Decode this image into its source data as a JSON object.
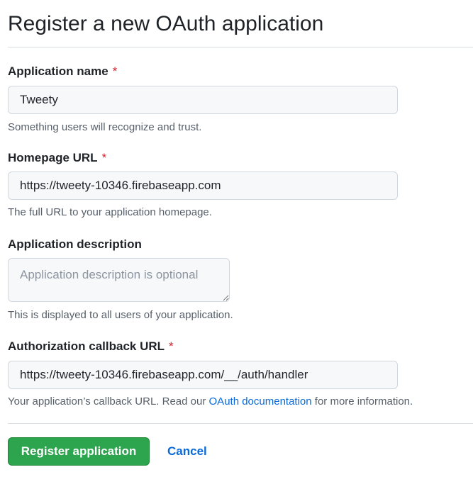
{
  "header": {
    "title": "Register a new OAuth application"
  },
  "form": {
    "app_name": {
      "label": "Application name",
      "required_mark": "*",
      "value": "Tweety",
      "hint": "Something users will recognize and trust."
    },
    "homepage_url": {
      "label": "Homepage URL",
      "required_mark": "*",
      "value": "https://tweety-10346.firebaseapp.com",
      "hint": "The full URL to your application homepage."
    },
    "description": {
      "label": "Application description",
      "value": "",
      "placeholder": "Application description is optional",
      "hint": "This is displayed to all users of your application."
    },
    "callback_url": {
      "label": "Authorization callback URL",
      "required_mark": "*",
      "value": "https://tweety-10346.firebaseapp.com/__/auth/handler",
      "hint_prefix": "Your application’s callback URL. Read our",
      "hint_link": "OAuth documentation",
      "hint_suffix": "for more information."
    }
  },
  "actions": {
    "submit_label": "Register application",
    "cancel_label": "Cancel"
  },
  "colors": {
    "primary_button": "#2da44e",
    "link": "#0969da",
    "required": "#d1242f"
  }
}
